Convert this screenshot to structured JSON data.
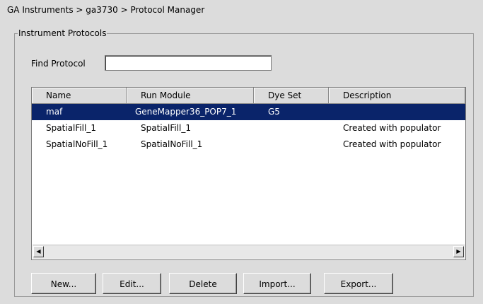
{
  "breadcrumb": "GA Instruments > ga3730 > Protocol Manager",
  "group_title": "Instrument Protocols",
  "find": {
    "label": "Find Protocol",
    "value": ""
  },
  "table": {
    "columns": [
      "Name",
      "Run Module",
      "Dye Set",
      "Description"
    ],
    "rows": [
      {
        "name": "maf",
        "run_module": "GeneMapper36_POP7_1",
        "dye_set": "G5",
        "description": "",
        "selected": true
      },
      {
        "name": "SpatialFill_1",
        "run_module": "SpatialFill_1",
        "dye_set": "",
        "description": "Created with populator",
        "selected": false
      },
      {
        "name": "SpatialNoFill_1",
        "run_module": "SpatialNoFill_1",
        "dye_set": "",
        "description": "Created with populator",
        "selected": false
      }
    ]
  },
  "scroll": {
    "left_icon": "◀",
    "right_icon": "▶"
  },
  "buttons": {
    "new": "New...",
    "edit": "Edit...",
    "delete": "Delete",
    "import": "Import...",
    "export": "Export..."
  },
  "colors": {
    "selection": "#0a246a",
    "background": "#dcdcdc"
  }
}
